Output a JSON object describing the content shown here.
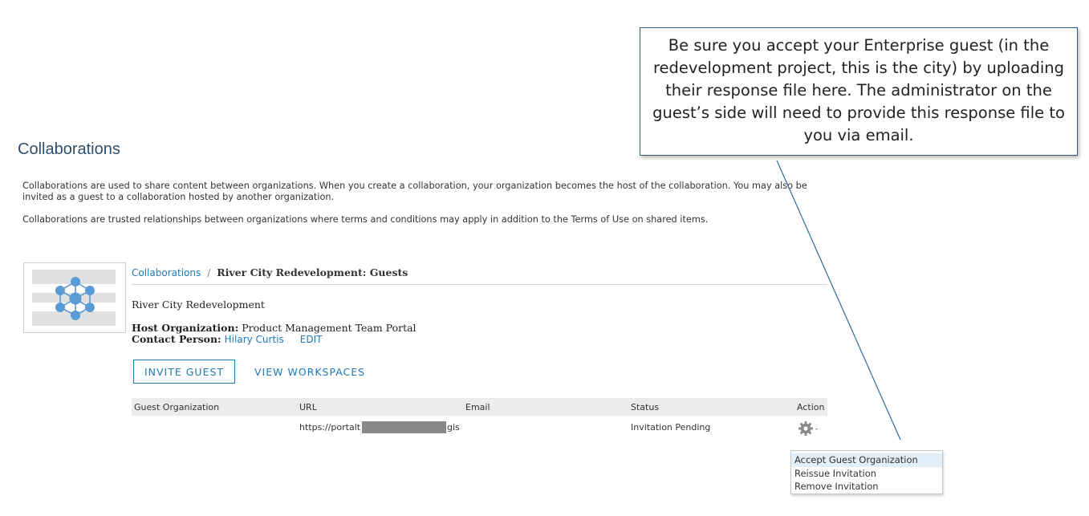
{
  "callout": {
    "text": "Be sure you accept your Enterprise guest (in the redevelopment project, this is the city) by uploading their response file here. The administrator on the guest’s side will need to provide this response file to you via email."
  },
  "page": {
    "title": "Collaborations",
    "description1": "Collaborations are used to share content between organizations. When you create a collaboration, your organization becomes the host of the collaboration. You may also be invited as a guest to a collaboration hosted by another organization.",
    "description2": "Collaborations are trusted relationships between organizations where terms and conditions may apply in addition to the Terms of Use on shared items."
  },
  "breadcrumb": {
    "root": "Collaborations",
    "separator": "/",
    "current": "River City Redevelopment: Guests"
  },
  "collaboration": {
    "name": "River City Redevelopment",
    "host_label": "Host Organization:",
    "host_value": "Product Management Team Portal",
    "contact_label": "Contact Person:",
    "contact_value": "Hilary Curtis",
    "edit_label": "EDIT"
  },
  "actions": {
    "invite_guest": "INVITE GUEST",
    "view_workspaces": "VIEW WORKSPACES"
  },
  "table": {
    "headers": {
      "guest_org": "Guest Organization",
      "url": "URL",
      "email": "Email",
      "status": "Status",
      "action": "Action"
    },
    "rows": [
      {
        "guest_org": "",
        "url_start": "https://portalt",
        "url_end": "gis",
        "email": "",
        "status": "Invitation Pending",
        "action_icon": "gear-icon"
      }
    ]
  },
  "action_menu": {
    "items": [
      "Accept Guest Organization",
      "Reissue Invitation",
      "Remove Invitation"
    ],
    "highlighted_index": 0
  },
  "colors": {
    "accent": "#1f7ab8",
    "title": "#2d4f6d",
    "callout_border": "#2e5f8a",
    "menu_highlight": "#e2eef8"
  }
}
